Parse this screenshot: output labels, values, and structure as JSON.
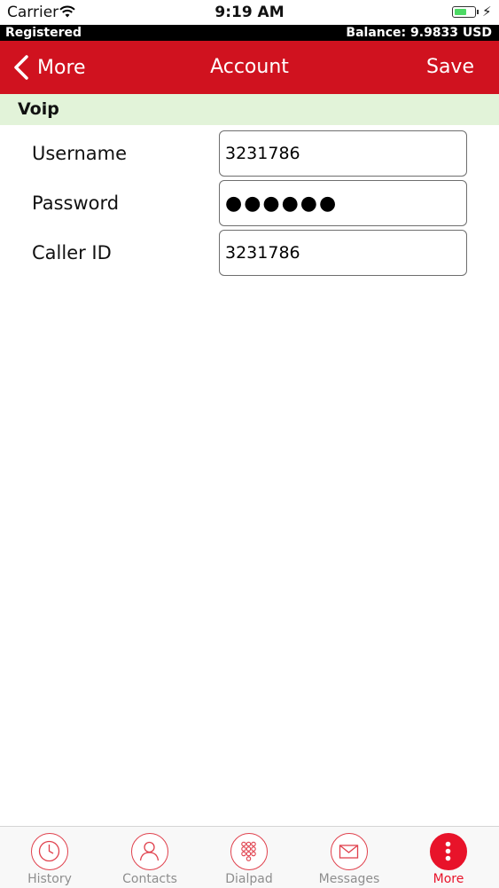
{
  "status_bar": {
    "carrier": "Carrier",
    "time": "9:19 AM",
    "battery_level": 0.6,
    "battery_color": "#4cd964"
  },
  "account_bar": {
    "status": "Registered",
    "balance": "Balance: 9.9833 USD"
  },
  "nav": {
    "back_label": "More",
    "title": "Account",
    "save_label": "Save",
    "color": "#d0121f"
  },
  "section": {
    "title": "Voip",
    "color": "#e2f3d9"
  },
  "form": {
    "username": {
      "label": "Username",
      "value": "3231786"
    },
    "password": {
      "label": "Password",
      "value": "●●●●●●"
    },
    "caller_id": {
      "label": "Caller ID",
      "value": "3231786"
    }
  },
  "tabs": {
    "history": {
      "label": "History",
      "icon": "clock-icon"
    },
    "contacts": {
      "label": "Contacts",
      "icon": "person-icon"
    },
    "dialpad": {
      "label": "Dialpad",
      "icon": "dialpad-icon"
    },
    "messages": {
      "label": "Messages",
      "icon": "envelope-icon"
    },
    "more": {
      "label": "More",
      "icon": "more-dots-icon"
    },
    "active": "more",
    "accent_color": "#e8132a"
  }
}
